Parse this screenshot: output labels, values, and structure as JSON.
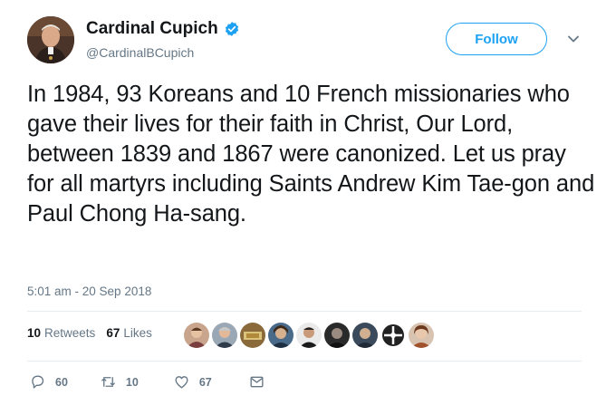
{
  "author": {
    "name": "Cardinal Cupich",
    "handle": "@CardinalBCupich",
    "verified": true
  },
  "header": {
    "follow_label": "Follow"
  },
  "tweet": {
    "text": "In 1984, 93 Koreans and 10 French missionaries who gave their lives for their faith in Christ, Our Lord, between 1839 and 1867 were canonized. Let us pray for all martyrs including Saints Andrew Kim Tae-gon and Paul Chong Ha-sang.",
    "timestamp": "5:01 am - 20 Sep 2018"
  },
  "stats": {
    "retweets_count": "10",
    "retweets_label": "Retweets",
    "likes_count": "67",
    "likes_label": "Likes"
  },
  "actions": {
    "reply_count": "60",
    "retweet_count": "10",
    "like_count": "67"
  },
  "colors": {
    "accent": "#1da1f2",
    "text": "#14171a",
    "muted": "#657786",
    "divider": "#e6ecf0"
  }
}
